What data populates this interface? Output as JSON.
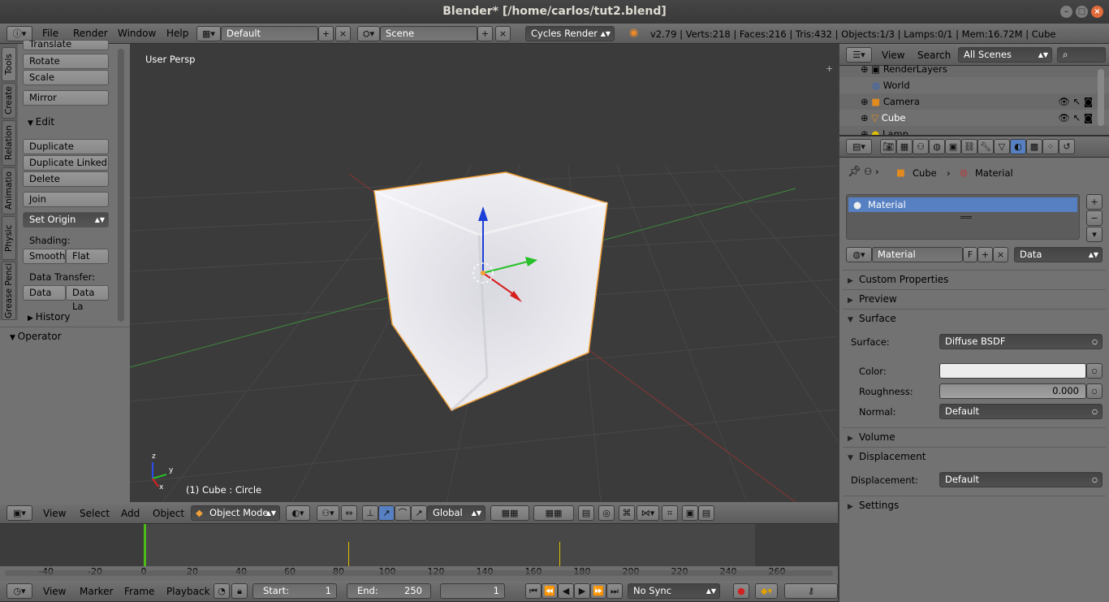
{
  "window": {
    "title": "Blender* [/home/carlos/tut2.blend]"
  },
  "top_menu": [
    "File",
    "Render",
    "Window",
    "Help"
  ],
  "screen_layout": "Default",
  "scene": "Scene",
  "render_engine": "Cycles Render",
  "stats": "v2.79 | Verts:218 | Faces:216 | Tris:432 | Objects:1/3 | Lamps:0/1 | Mem:16.72M | Cube",
  "tool_tabs": [
    "Tools",
    "Create",
    "Relation",
    "Animatio",
    "Physic",
    "Grease Penci"
  ],
  "tool_shelf": {
    "translate": "Translate",
    "rotate": "Rotate",
    "scale": "Scale",
    "mirror": "Mirror",
    "edit_header": "Edit",
    "duplicate": "Duplicate",
    "duplicate_linked": "Duplicate Linked",
    "delete": "Delete",
    "join": "Join",
    "set_origin": "Set Origin",
    "shading_label": "Shading:",
    "smooth": "Smooth",
    "flat": "Flat",
    "data_transfer_label": "Data Transfer:",
    "data": "Data",
    "data_layout": "Data La",
    "history_header": "History",
    "operator_header": "Operator"
  },
  "viewport": {
    "view_name": "User Persp",
    "object_info": "(1) Cube : Circle",
    "axis_x": "x",
    "axis_y": "y",
    "axis_z": "z"
  },
  "view_header": {
    "menus": [
      "View",
      "Select",
      "Add",
      "Object"
    ],
    "mode": "Object Mode",
    "orientation": "Global"
  },
  "outliner": {
    "menus": [
      "View",
      "Search"
    ],
    "filter": "All Scenes",
    "items": [
      "RenderLayers",
      "World",
      "Camera",
      "Cube",
      "Lamp"
    ]
  },
  "properties": {
    "breadcrumb": [
      "Cube",
      "Material"
    ],
    "material_slot": "Material",
    "material_name": "Material",
    "fake_user": "F",
    "link": "Data",
    "panels": {
      "custom_properties": "Custom Properties",
      "preview": "Preview",
      "surface": "Surface",
      "volume": "Volume",
      "displacement": "Displacement",
      "settings": "Settings"
    },
    "surface_label": "Surface:",
    "surface_value": "Diffuse BSDF",
    "color_label": "Color:",
    "roughness_label": "Roughness:",
    "roughness_value": "0.000",
    "normal_label": "Normal:",
    "normal_value": "Default",
    "displacement_label": "Displacement:",
    "displacement_value": "Default"
  },
  "timeline": {
    "ticks": [
      "-40",
      "-20",
      "0",
      "20",
      "40",
      "60",
      "80",
      "100",
      "120",
      "140",
      "160",
      "180",
      "200",
      "220",
      "240",
      "260"
    ],
    "menus": [
      "View",
      "Marker",
      "Frame",
      "Playback"
    ],
    "start_label": "Start:",
    "start": "1",
    "end_label": "End:",
    "end": "250",
    "current_frame": "1",
    "sync": "No Sync"
  },
  "colors": {
    "selected_row": "#5680c2",
    "outline_select": "#f0a13a",
    "accent_green": "#4cbb17"
  }
}
